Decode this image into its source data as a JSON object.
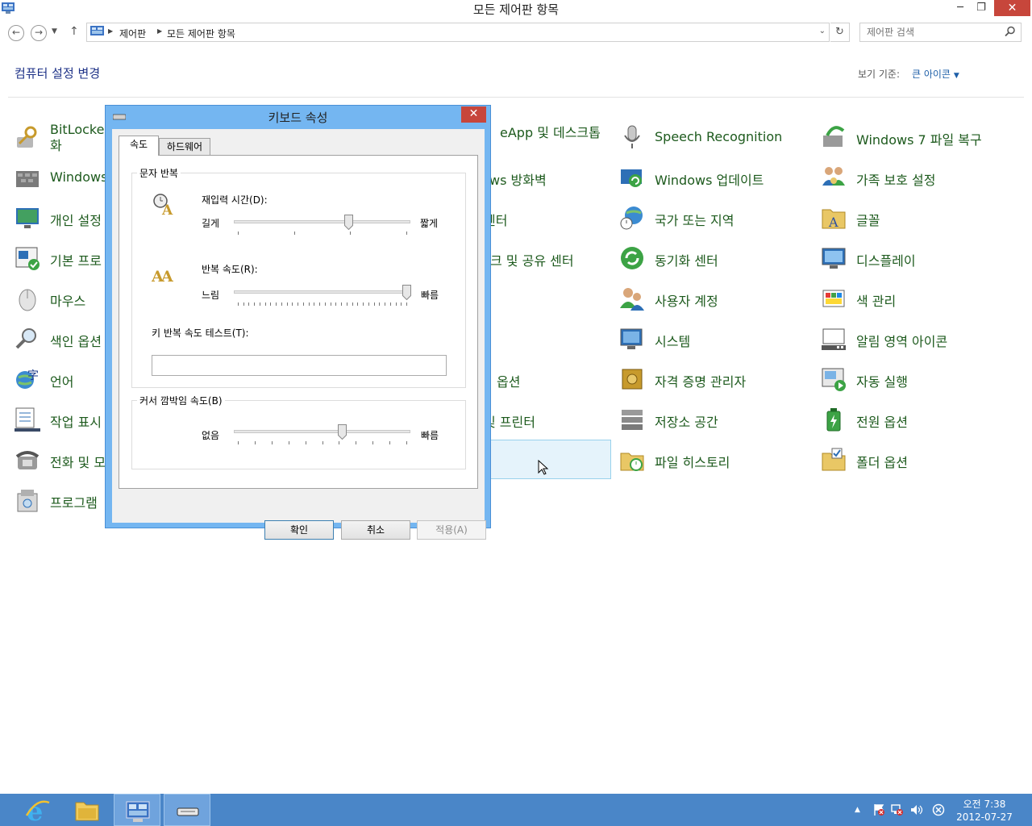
{
  "window": {
    "title": "모든 제어판 항목",
    "min": "─",
    "max": "❐",
    "close": "✕"
  },
  "nav": {
    "back": "←",
    "forward": "→",
    "history": "▼",
    "up": "↑",
    "breadcrumb": [
      "제어판",
      "모든 제어판 항목"
    ],
    "refresh": "↻",
    "search_placeholder": "제어판 검색",
    "search_icon": "search-icon"
  },
  "header": {
    "title": "컴퓨터 설정 변경",
    "view_by_label": "보기 기준:",
    "view_by_value": "큰 아이콘"
  },
  "items": {
    "col1": [
      "BitLocker 드라이브 암호화",
      "Windows Defender",
      "개인 설정",
      "기본 프로그램",
      "마우스",
      "색인 옵션",
      "언어",
      "작업 표시줄",
      "전화 및 모뎀",
      "프로그램 및 기능"
    ],
    "col1_visible": [
      "BitLocker",
      "화",
      "Windows",
      "개인 설정",
      "기본 프로",
      "마우스",
      "색인 옵션",
      "언어",
      "작업 표시",
      "전화 및 모",
      "프로그램"
    ],
    "col2_visible": [
      "eApp 및 데스크톱",
      "ws 방화벽",
      "센터",
      "크 및 공유 센터",
      "옵션",
      "및 프린터"
    ],
    "col3": [
      "Speech Recognition",
      "Windows 업데이트",
      "국가 또는 지역",
      "동기화 센터",
      "사용자 계정",
      "시스템",
      "자격 증명 관리자",
      "저장소 공간",
      "파일 히스토리"
    ],
    "col4": [
      "Windows 7 파일 복구",
      "가족 보호 설정",
      "글꼴",
      "디스플레이",
      "색 관리",
      "알림 영역 아이콘",
      "자동 실행",
      "전원 옵션",
      "폴더 옵션"
    ]
  },
  "dialog": {
    "title": "키보드 속성",
    "close": "✕",
    "tabs": [
      "속도",
      "하드웨어"
    ],
    "group1": {
      "label": "문자 반복",
      "delay_label": "재입력 시간(D):",
      "delay_left": "길게",
      "delay_right": "짧게",
      "delay_value": 0.66,
      "rate_label": "반복 속도(R):",
      "rate_left": "느림",
      "rate_right": "빠름",
      "rate_value": 1.0,
      "test_label": "키 반복 속도 테스트(T):",
      "test_value": ""
    },
    "group2": {
      "label": "커서 깜박임 속도(B)",
      "left": "없음",
      "right": "빠름",
      "value": 0.62
    },
    "buttons": {
      "ok": "확인",
      "cancel": "취소",
      "apply": "적용(A)"
    }
  },
  "taskbar": {
    "apps": [
      "internet-explorer",
      "file-explorer",
      "control-panel",
      "keyboard-properties"
    ],
    "clock_top": "오전 7:38",
    "clock_bottom": "2012-07-27",
    "tray_arrow": "▲"
  }
}
